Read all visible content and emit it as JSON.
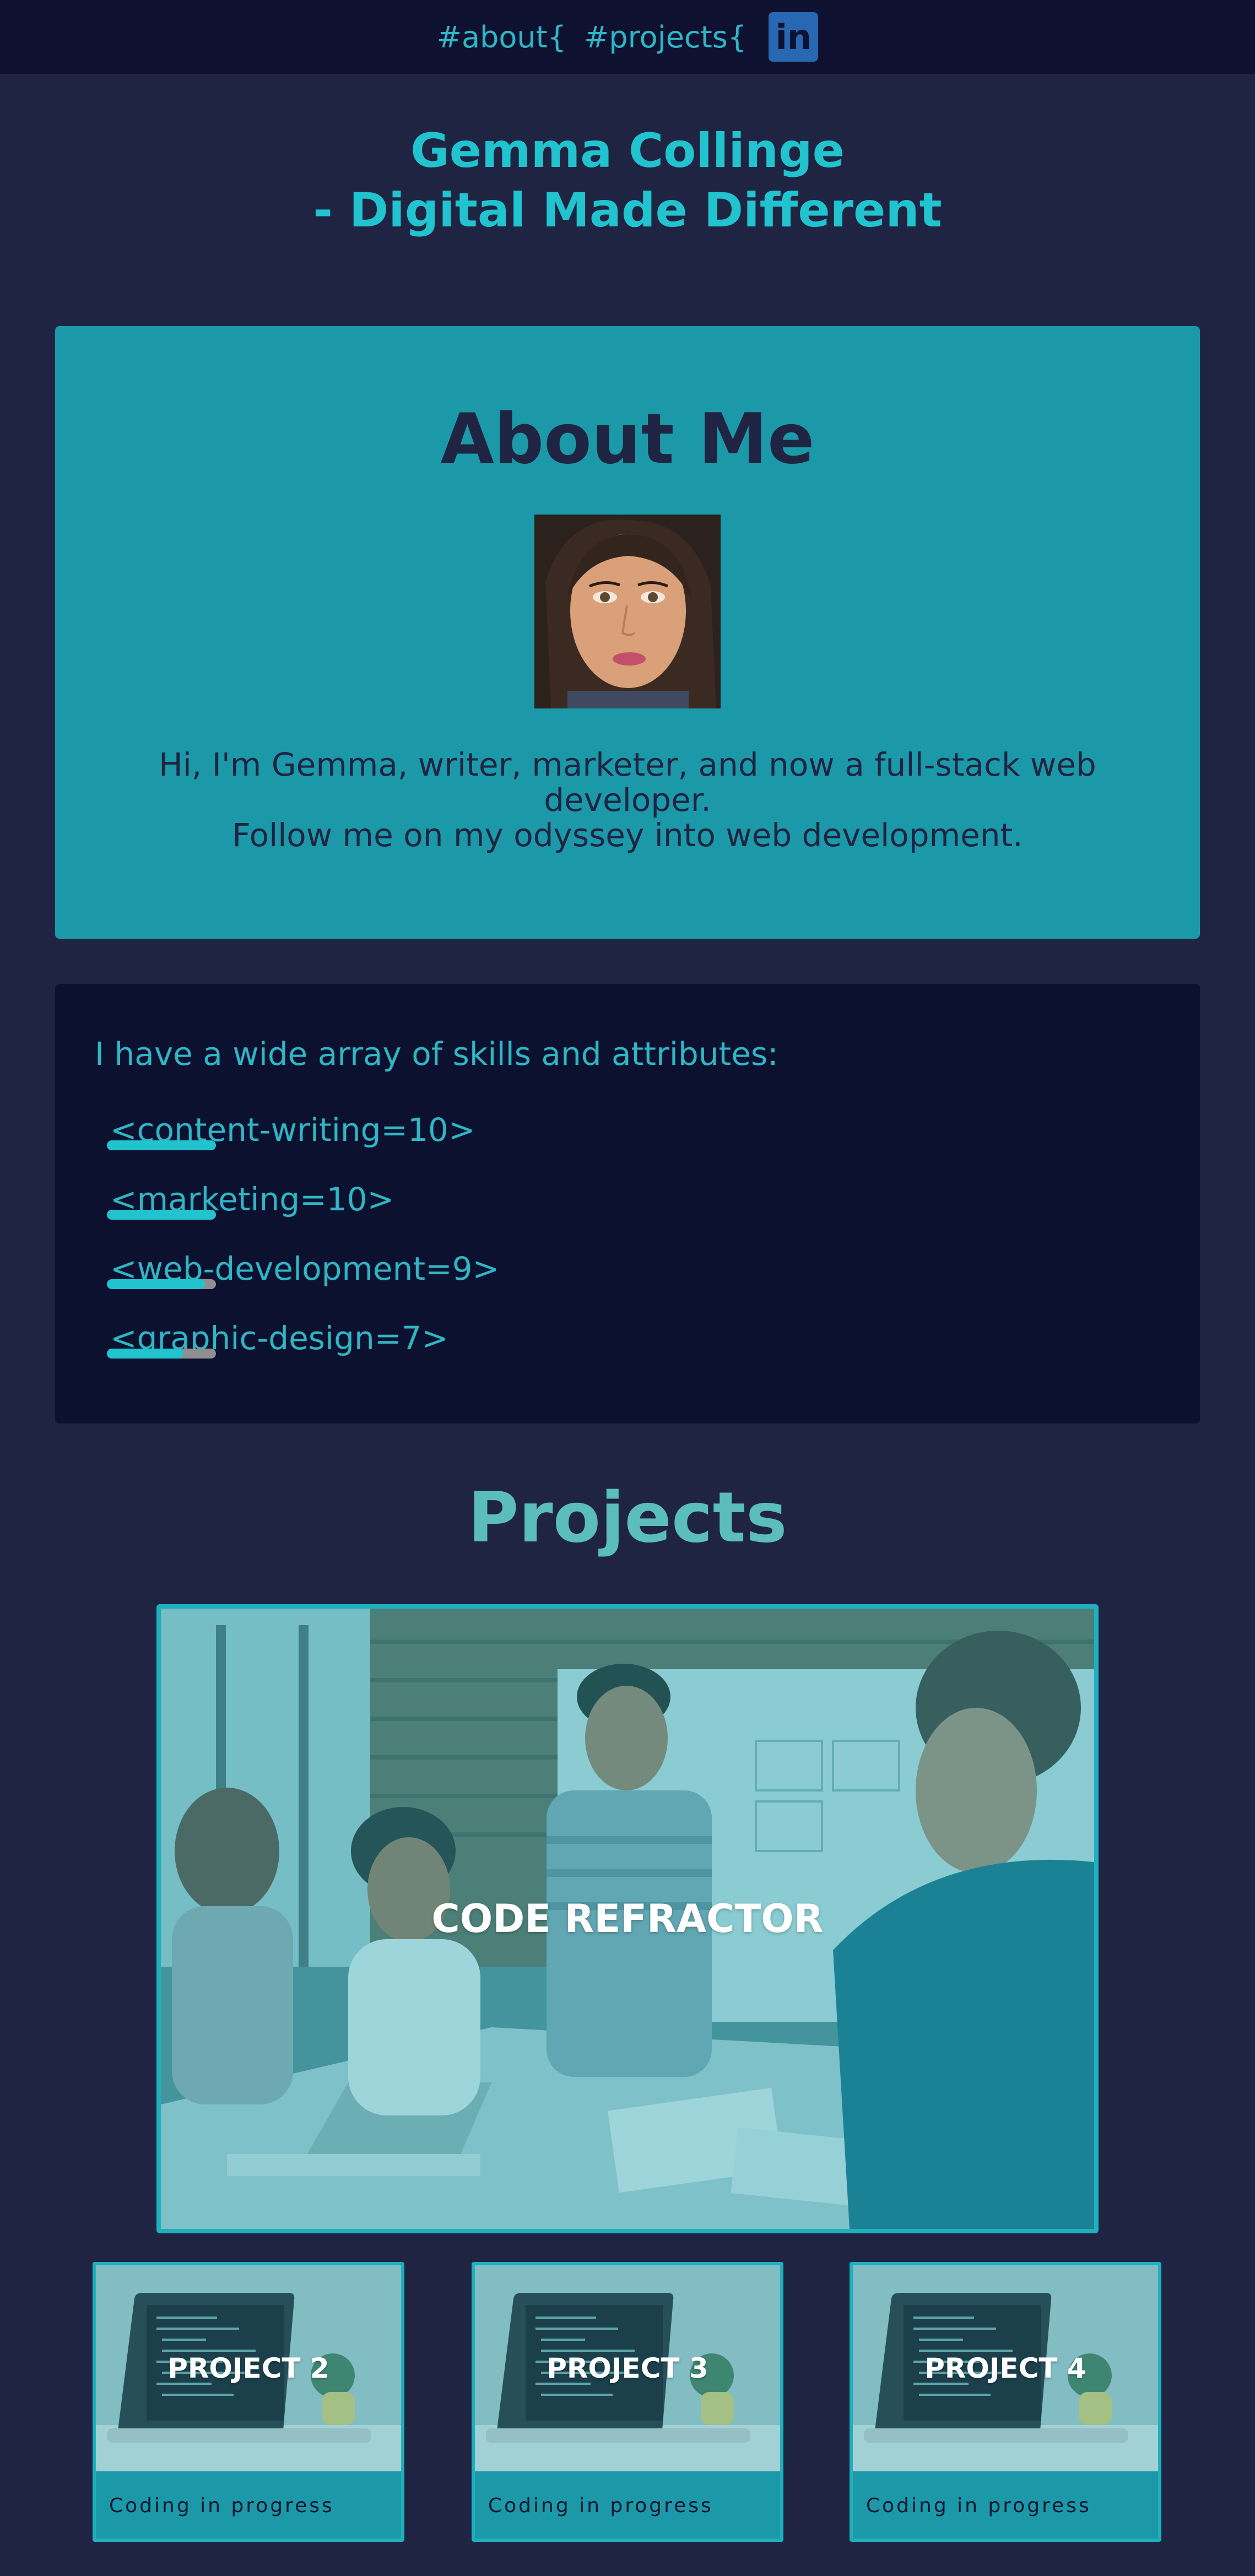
{
  "nav": {
    "about_link": "#about{",
    "projects_link": "#projects{",
    "linkedin_label": "in"
  },
  "hero": {
    "title_line1": "Gemma Collinge",
    "title_line2": "- Digital Made Different"
  },
  "about": {
    "title": "About Me",
    "text_line1": "Hi, I'm Gemma, writer, marketer, and now a full-stack web developer.",
    "text_line2": "Follow me on my odyssey into web development."
  },
  "skills": {
    "intro": "I have a wide array of skills and attributes:",
    "items": [
      {
        "label": "<content-writing=10>",
        "level": 1.0
      },
      {
        "label": "<marketing=10>",
        "level": 1.0
      },
      {
        "label": "<web-development=9>",
        "level": 0.9
      },
      {
        "label": "<graphic-design=7>",
        "level": 0.7
      }
    ]
  },
  "projects": {
    "title": "Projects",
    "featured": {
      "title": "CODE REFRACTOR"
    },
    "cards": [
      {
        "title": "PROJECT 2",
        "status": "Coding in progress"
      },
      {
        "title": "PROJECT 3",
        "status": "Coding in progress"
      },
      {
        "title": "PROJECT 4",
        "status": "Coding in progress"
      }
    ]
  },
  "colors": {
    "page_bg": "#1e2442",
    "nav_bg": "#0e1130",
    "accent": "#21c3cf",
    "card_teal": "#1b99a8",
    "skills_bg": "#0d1130"
  }
}
